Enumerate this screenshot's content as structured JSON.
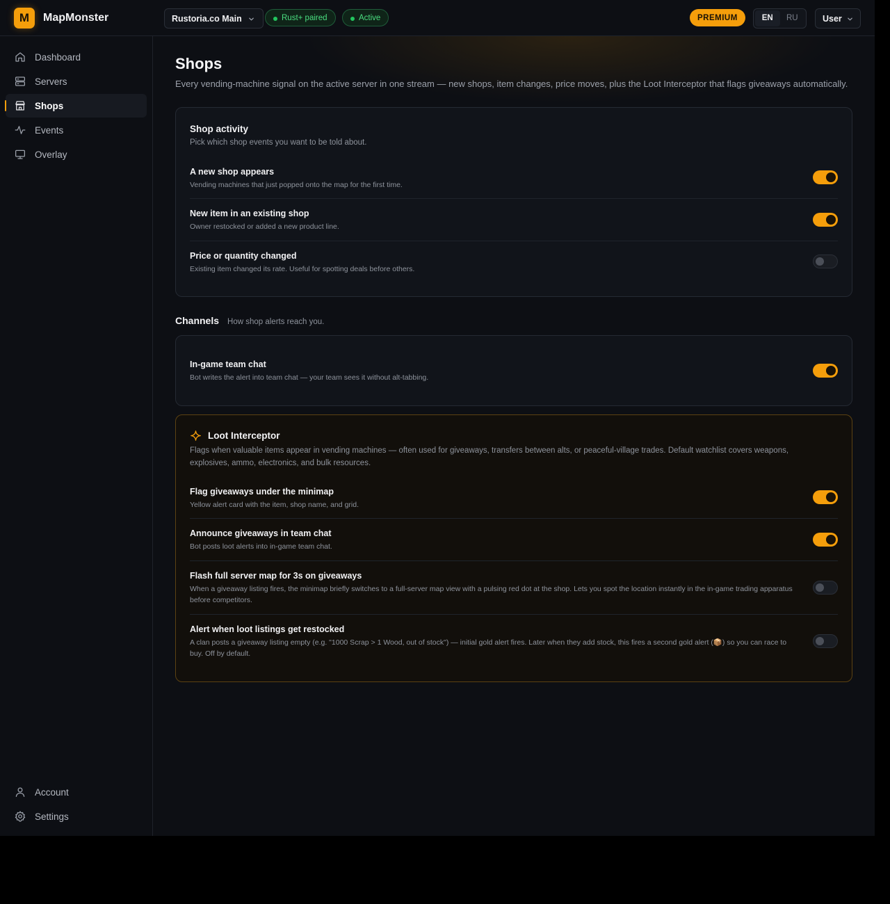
{
  "app": {
    "name": "MapMonster",
    "logo_letter": "M",
    "accent_color": "#f59e0b"
  },
  "header": {
    "server_name": "Rustoria.co Main",
    "paired_label": "Rust+ paired",
    "active_label": "Active",
    "premium_label": "PREMIUM",
    "lang_en": "EN",
    "lang_ru": "RU",
    "user_label": "User"
  },
  "sidebar": {
    "items": [
      {
        "label": "Dashboard",
        "icon": "home-icon"
      },
      {
        "label": "Servers",
        "icon": "servers-icon"
      },
      {
        "label": "Shops",
        "icon": "shop-icon",
        "active": true
      },
      {
        "label": "Events",
        "icon": "activity-icon"
      },
      {
        "label": "Overlay",
        "icon": "monitor-icon"
      }
    ],
    "bottom": [
      {
        "label": "Account",
        "icon": "user-icon"
      },
      {
        "label": "Settings",
        "icon": "gear-icon"
      }
    ]
  },
  "page": {
    "title": "Shops",
    "description": "Every vending-machine signal on the active server in one stream — new shops, item changes, price moves, plus the Loot Interceptor that flags giveaways automatically."
  },
  "shop_activity": {
    "title": "Shop activity",
    "subtitle": "Pick which shop events you want to be told about.",
    "rows": [
      {
        "title": "A new shop appears",
        "desc": "Vending machines that just popped onto the map for the first time.",
        "on": true
      },
      {
        "title": "New item in an existing shop",
        "desc": "Owner restocked or added a new product line.",
        "on": true
      },
      {
        "title": "Price or quantity changed",
        "desc": "Existing item changed its rate. Useful for spotting deals before others.",
        "on": false
      }
    ]
  },
  "channels": {
    "title": "Channels",
    "subtitle": "How shop alerts reach you.",
    "rows": [
      {
        "title": "In-game team chat",
        "desc": "Bot writes the alert into team chat — your team sees it without alt-tabbing.",
        "on": true
      }
    ]
  },
  "loot_interceptor": {
    "title": "Loot Interceptor",
    "icon": "sparkle-icon",
    "description": "Flags when valuable items appear in vending machines — often used for giveaways, transfers between alts, or peaceful-village trades. Default watchlist covers weapons, explosives, ammo, electronics, and bulk resources.",
    "rows": [
      {
        "title": "Flag giveaways under the minimap",
        "desc": "Yellow alert card with the item, shop name, and grid.",
        "on": true
      },
      {
        "title": "Announce giveaways in team chat",
        "desc": "Bot posts loot alerts into in-game team chat.",
        "on": true
      },
      {
        "title": "Flash full server map for 3s on giveaways",
        "desc": "When a giveaway listing fires, the minimap briefly switches to a full-server map view with a pulsing red dot at the shop. Lets you spot the location instantly in the in-game trading apparatus before competitors.",
        "on": false
      },
      {
        "title": "Alert when loot listings get restocked",
        "desc": "A clan posts a giveaway listing empty (e.g. \"1000 Scrap > 1 Wood, out of stock\") — initial gold alert fires. Later when they add stock, this fires a second gold alert (📦) so you can race to buy. Off by default.",
        "on": false
      }
    ]
  }
}
